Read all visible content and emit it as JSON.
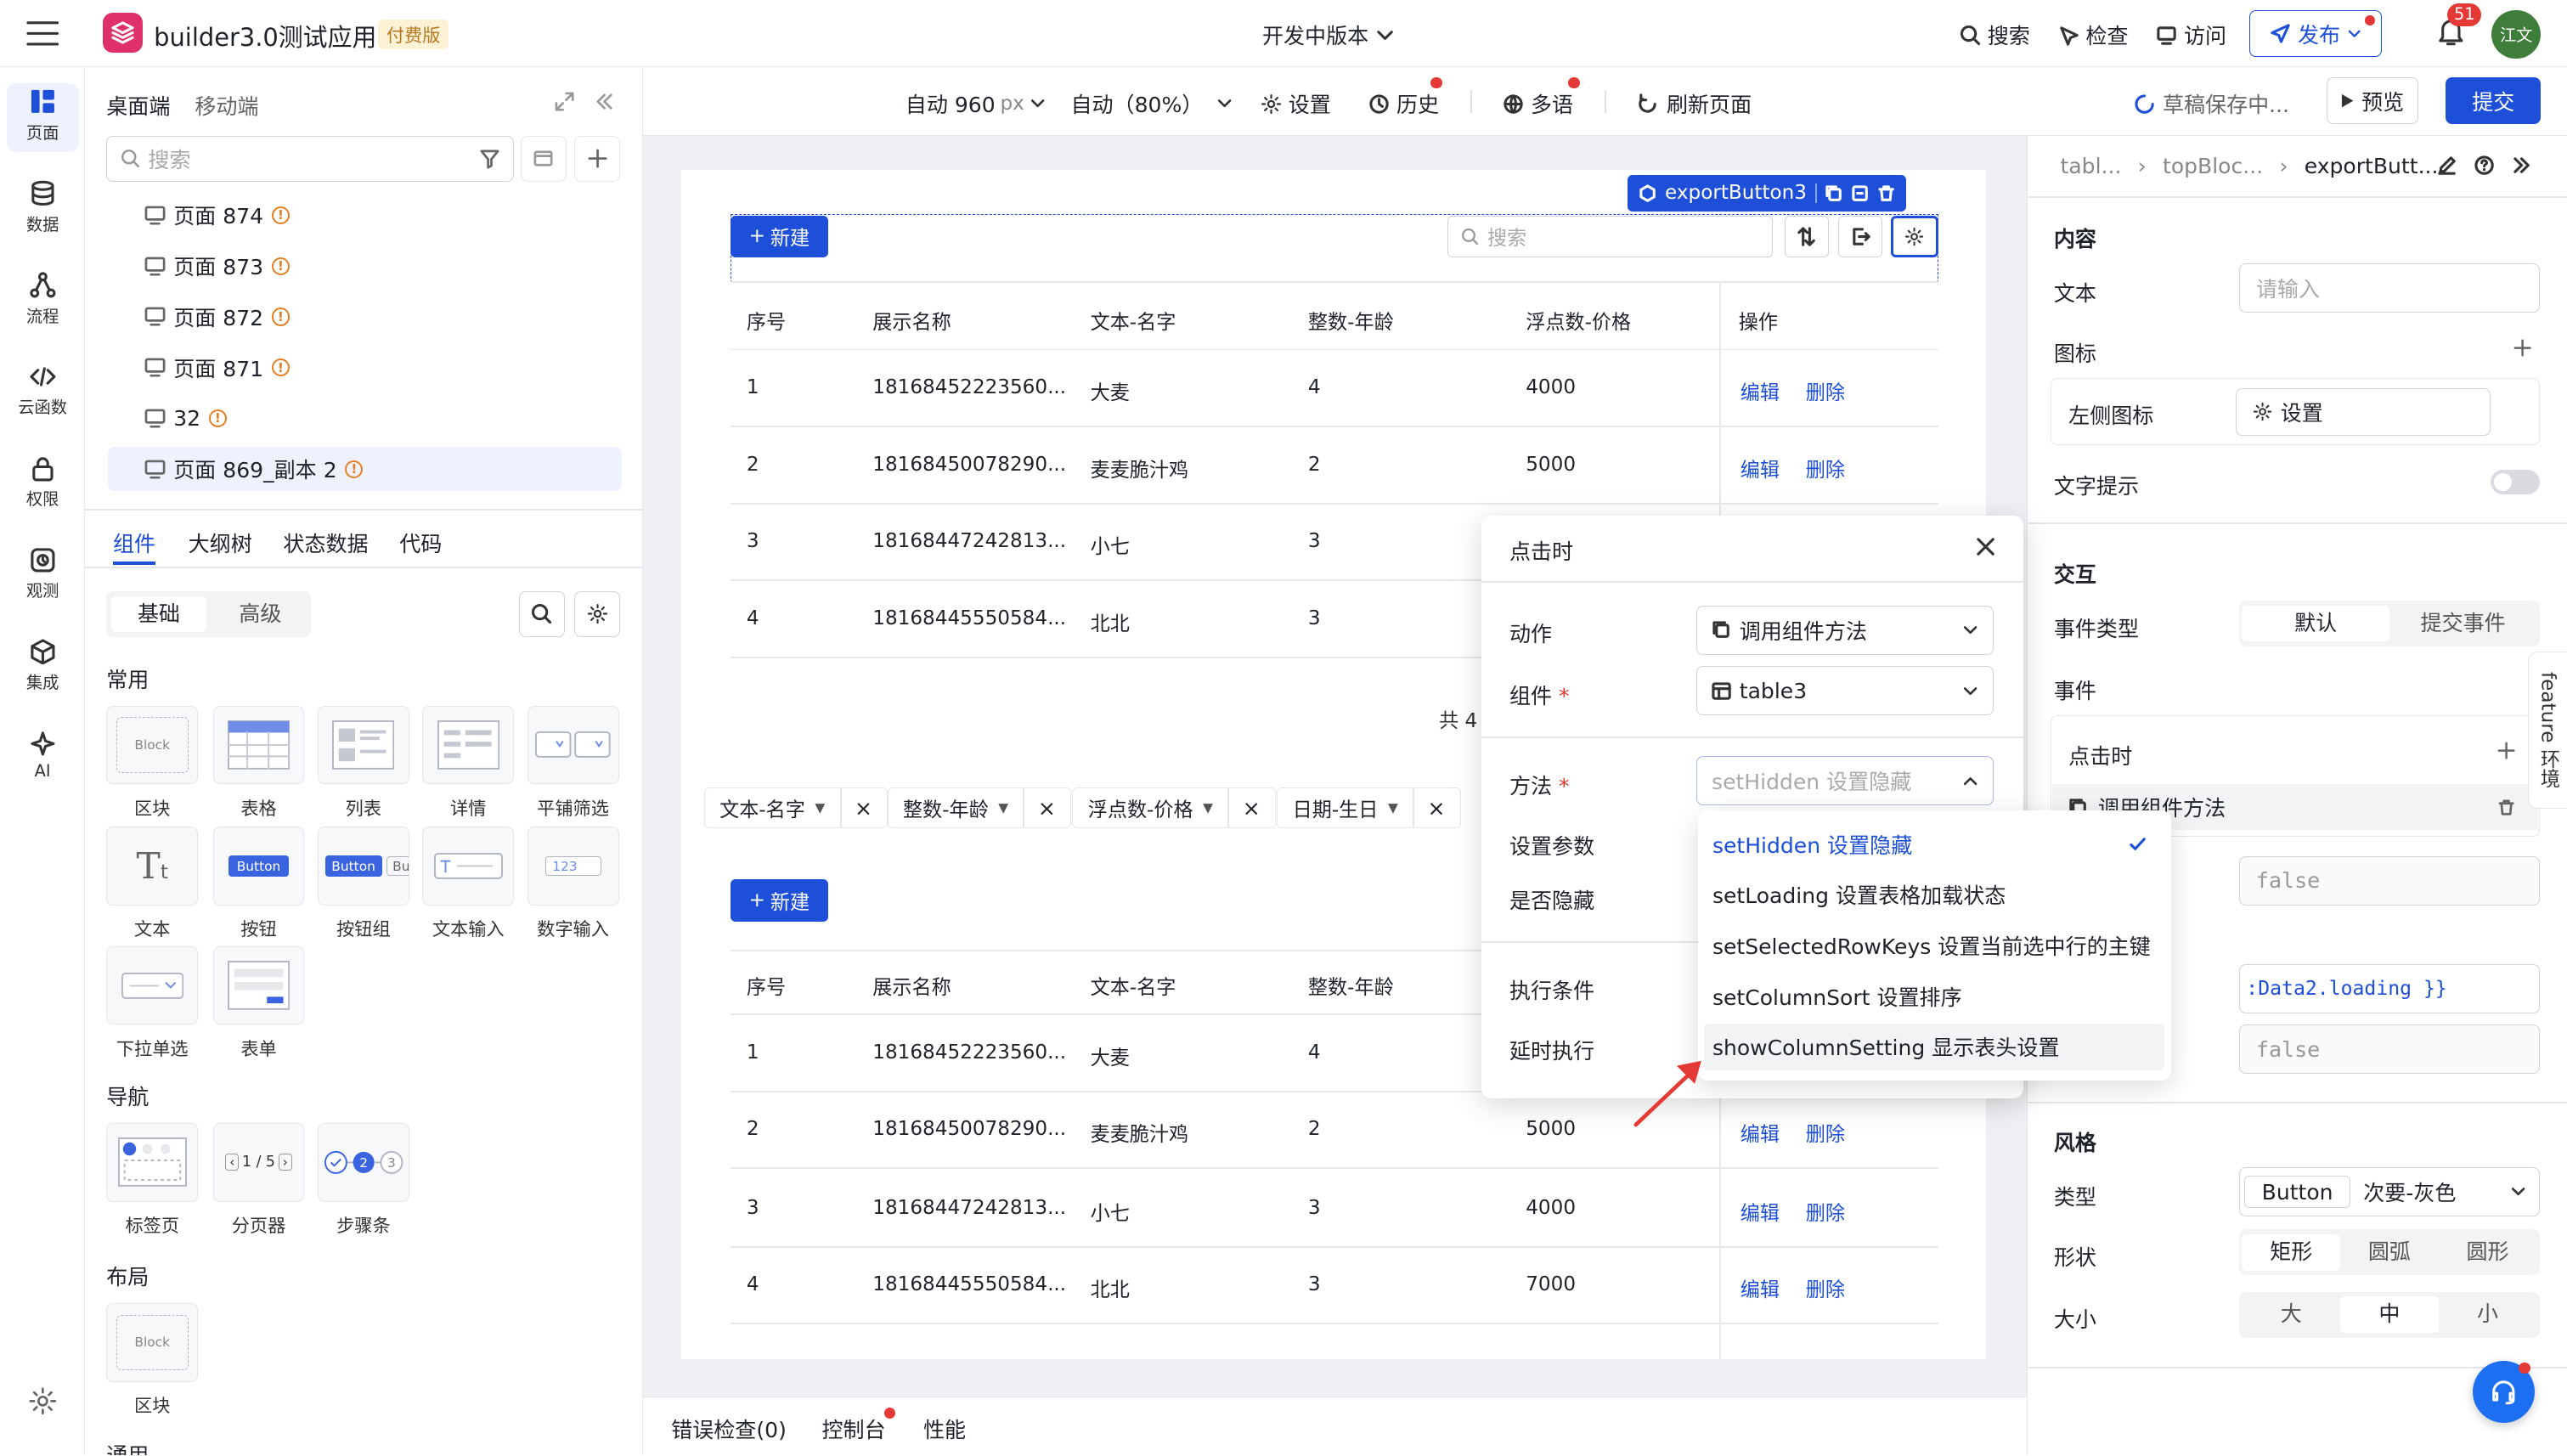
{
  "app": {
    "name": "builder3.0测试应用",
    "plan_badge": "付费版",
    "version": "开发中版本"
  },
  "topbar": {
    "search": "搜索",
    "inspect": "检查",
    "visit": "访问",
    "publish": "发布",
    "notif_count": "51",
    "avatar": "江文"
  },
  "rail": [
    {
      "label": "页面",
      "icon": "page-icon"
    },
    {
      "label": "数据",
      "icon": "database-icon"
    },
    {
      "label": "流程",
      "icon": "flow-icon"
    },
    {
      "label": "云函数",
      "icon": "code-icon"
    },
    {
      "label": "权限",
      "icon": "lock-icon"
    },
    {
      "label": "观测",
      "icon": "observe-icon"
    },
    {
      "label": "集成",
      "icon": "cube-icon"
    },
    {
      "label": "AI",
      "icon": "sparkle-icon"
    }
  ],
  "panel": {
    "tab_desktop": "桌面端",
    "tab_mobile": "移动端",
    "search_placeholder": "搜索",
    "pages": [
      "页面 874",
      "页面 873",
      "页面 872",
      "页面 871",
      "32",
      "页面 869_副本 2"
    ],
    "tabs": [
      "组件",
      "大纲树",
      "状态数据",
      "代码"
    ],
    "sub_tabs": [
      "基础",
      "高级"
    ],
    "sections": {
      "common": "常用",
      "nav": "导航",
      "layout": "布局",
      "general": "通用"
    },
    "common_items": [
      "区块",
      "表格",
      "列表",
      "详情",
      "平铺筛选",
      "文本",
      "按钮",
      "按钮组",
      "文本输入",
      "数字输入",
      "下拉单选",
      "表单"
    ],
    "nav_items": [
      "标签页",
      "分页器",
      "步骤条"
    ],
    "layout_items": [
      "区块"
    ],
    "thumb_texts": {
      "block": "Block",
      "button": "Button",
      "button2": "Butt",
      "num": "123",
      "pager": "1 / 5"
    }
  },
  "toolbar": {
    "width": "自动 960",
    "width_unit": "px",
    "zoom": "自动（80%）",
    "settings": "设置",
    "history": "历史",
    "i18n": "多语",
    "refresh": "刷新页面",
    "saving": "草稿保存中...",
    "preview": "预览",
    "submit": "提交"
  },
  "canvas": {
    "selected_tag": "exportButton3",
    "new_btn": "新建",
    "search_placeholder": "搜索",
    "columns": [
      "序号",
      "展示名称",
      "文本-名字",
      "整数-年龄",
      "浮点数-价格",
      "操作"
    ],
    "rows1": [
      [
        "1",
        "18168452223560...",
        "大麦",
        "4",
        "4000"
      ],
      [
        "2",
        "18168450078290...",
        "麦麦脆汁鸡",
        "2",
        "5000"
      ],
      [
        "3",
        "18168447242813...",
        "小七",
        "3",
        ""
      ],
      [
        "4",
        "18168445550584...",
        "北北",
        "3",
        ""
      ]
    ],
    "rows2": [
      [
        "1",
        "18168452223560...",
        "大麦",
        "4",
        ""
      ],
      [
        "2",
        "18168450078290...",
        "麦麦脆汁鸡",
        "2",
        "5000"
      ],
      [
        "3",
        "18168447242813...",
        "小七",
        "3",
        "4000"
      ],
      [
        "4",
        "18168445550584...",
        "北北",
        "3",
        "7000"
      ]
    ],
    "edit": "编辑",
    "delete": "删除",
    "total_prefix": "共 4",
    "chips": [
      "文本-名字",
      "整数-年龄",
      "浮点数-价格",
      "日期-生日"
    ]
  },
  "bottombar": {
    "errors": "错误检查(0)",
    "console": "控制台",
    "perf": "性能"
  },
  "rpanel": {
    "breadcrumb": [
      "tabl...",
      "topBloc...",
      "exportButt..."
    ],
    "content": "内容",
    "text": "文本",
    "text_placeholder": "请输入",
    "icon": "图标",
    "left_icon": "左侧图标",
    "left_icon_value": "设置",
    "tooltip": "文字提示",
    "interaction": "交互",
    "event_type": "事件类型",
    "event_default": "默认",
    "event_submit": "提交事件",
    "events": "事件",
    "on_click": "点击时",
    "action_item": "调用组件方法",
    "val_false1": "false",
    "expr": ":Data2.loading }}",
    "val_false2": "false",
    "style": "风格",
    "type": "类型",
    "type_btn": "Button",
    "type_val": "次要-灰色",
    "shape": "形状",
    "shapes": [
      "矩形",
      "圆弧",
      "圆形"
    ],
    "size": "大小",
    "sizes": [
      "大",
      "中",
      "小"
    ],
    "side_tab": "feature 环境"
  },
  "modal": {
    "title": "点击时",
    "action_label": "动作",
    "action_value": "调用组件方法",
    "comp_label": "组件",
    "comp_value": "table3",
    "method_label": "方法",
    "method_placeholder": "setHidden 设置隐藏",
    "params_label": "设置参数",
    "hidden_label": "是否隐藏",
    "cond_label": "执行条件",
    "delay_label": "延时执行"
  },
  "dropdown": [
    "setHidden 设置隐藏",
    "setLoading 设置表格加载状态",
    "setSelectedRowKeys 设置当前选中行的主键",
    "setColumnSort 设置排序",
    "showColumnSetting 显示表头设置"
  ],
  "colors": {
    "primary": "#1d4fd8",
    "warn": "#e67e22",
    "badge": "#e53935"
  }
}
